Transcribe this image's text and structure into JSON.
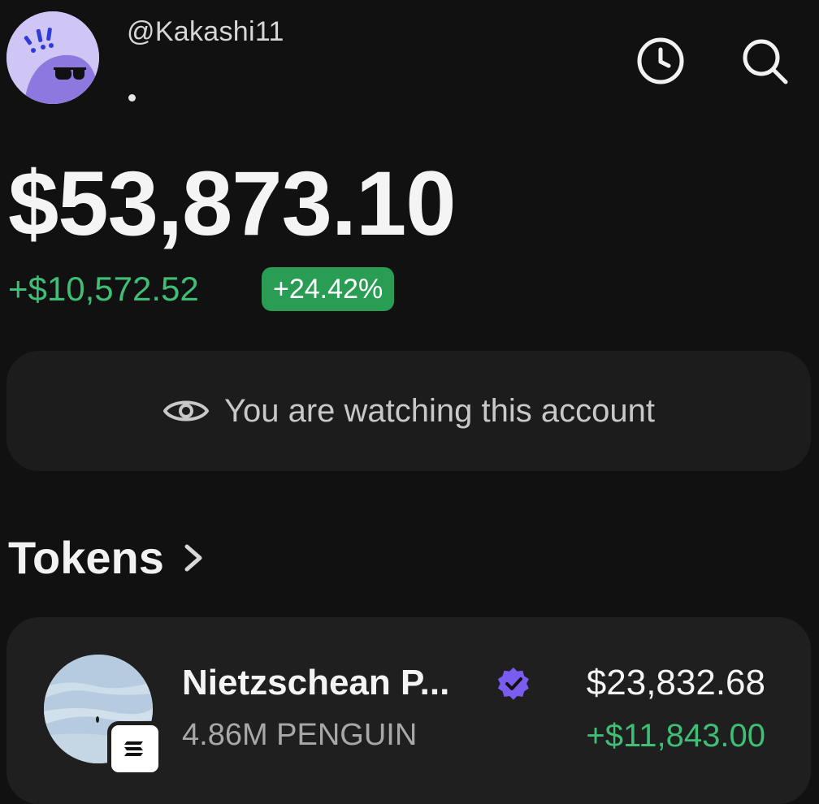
{
  "profile": {
    "handle": "@Kakashi11",
    "avatar_icon": "sunglasses-character-avatar",
    "avatar_color": "#c9c0f2"
  },
  "header_icons": {
    "history": "clock-icon",
    "search": "search-icon"
  },
  "portfolio": {
    "balance": "$53,873.10",
    "change_amount": "+$10,572.52",
    "change_percent": "+24.42%",
    "positive_color": "#3fbf75"
  },
  "watch_banner": {
    "icon": "eye-icon",
    "text": "You are watching this account"
  },
  "tokens": {
    "title": "Tokens",
    "items": [
      {
        "name": "Nietzschean P...",
        "amount": "4.86M PENGUIN",
        "value": "$23,832.68",
        "pnl": "+$11,843.00",
        "verified_icon": "verified-badge-icon",
        "chain_icon": "solana-icon"
      }
    ]
  }
}
